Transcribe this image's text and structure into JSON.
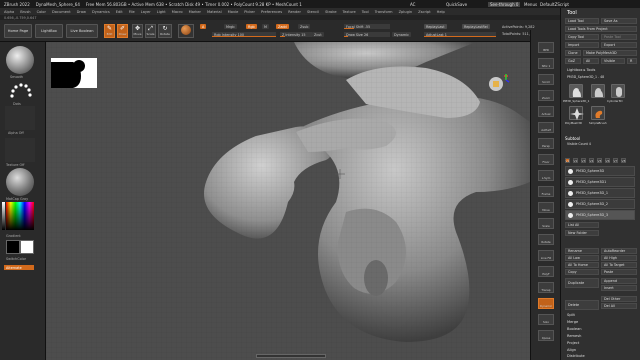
{
  "titlebar": {
    "app": "ZBrush 2022",
    "doc": "DynaMesh_Sphere_64",
    "stats": "Free Mem 56.803GB • Active Mem 638 • Scratch Disk 49 • Timer 0.002 • PolyCount 9.28 KP • MeshCount 1",
    "ac": "AC",
    "quicksave": "QuickSave",
    "seethrough": "See-through 0",
    "menus": "Menus",
    "script": "DefaultZScript"
  },
  "menubar": [
    "Alpha",
    "Brush",
    "Color",
    "Document",
    "Draw",
    "Dynamics",
    "Edit",
    "File",
    "Layer",
    "Light",
    "Macro",
    "Marker",
    "Material",
    "Movie",
    "Picker",
    "Preferences",
    "Render",
    "Stencil",
    "Stroke",
    "Texture",
    "Tool",
    "Transform",
    "Zplugin",
    "Zscript",
    "Help"
  ],
  "statusline": "0.656,-0.759,0.647",
  "toolbar": {
    "home": "Home Page",
    "lightbox": "LightBox",
    "live_boolean": "Live Boolean",
    "edit": "Edit",
    "draw": "Draw",
    "move": "Move",
    "scale": "Scale",
    "rotate": "Rotate",
    "a": "A",
    "mrgb": "Mrgb",
    "rgb": "Rgb",
    "m": "M",
    "zadd": "Zadd",
    "zsub": "Zsub",
    "zcut": "Zcut",
    "rgb_intensity": "Rgb Intensity 100",
    "z_intensity": "Z Intensity 15",
    "focal_shift": "Focal Shift -55",
    "draw_size": "Draw Size 26",
    "dynamic": "Dynamic",
    "replay_last": "ReplayLast",
    "replay_last_rel": "ReplayLastRel",
    "adjust_last": "AdjustLast 1",
    "active_points": "ActivePoints: 9,282",
    "total_points": "TotalPoints: 511,648"
  },
  "leftshelf": {
    "brush": "Smooth",
    "stroke": "Dots",
    "alpha": "Alpha Off",
    "texture": "Texture Off",
    "material": "MatCap Gray",
    "gradient": "Gradient",
    "switch_color": "SwitchColor",
    "alternate": "Alternate"
  },
  "rightshelf": [
    "BPR",
    "SPix 1",
    "Scroll",
    "Zoom",
    "Actual",
    "AAHalf",
    "Persp",
    "Floor",
    "L.Sym",
    "Frame",
    "Move",
    "Scale",
    "Rotate",
    "Line Fill",
    "PolyF",
    "Transp",
    "Dynamic",
    "Solo",
    "Xpose"
  ],
  "toolpanel": {
    "title": "Tool",
    "load_tool": "Load Tool",
    "save_as": "Save As",
    "load_from_project": "Load Tools From Project",
    "copy_tool": "Copy Tool",
    "paste_tool": "Paste Tool",
    "import": "Import",
    "export": "Export",
    "clone": "Clone",
    "make_polymesh": "Make PolyMesh3D",
    "goz": "GoZ",
    "all": "All",
    "visible": "Visible",
    "r": "R",
    "lightbox_tools": "Lightbox ▸ Tools",
    "current_tool": "PM3D_Sphere3D_1 . 48",
    "tool_thumbs": [
      "PM3D_Sphere3D_1",
      "PM3D_Sphere3D",
      "Cylinder3D",
      "PolyMesh3D",
      "SimpleBrush"
    ],
    "subtool_header": "Subtool",
    "visible_count": "Visible Count 4",
    "v_numbers": [
      "V1",
      "V2",
      "V3",
      "V4",
      "V5",
      "V6",
      "V7",
      "V8"
    ],
    "subtools": [
      "PM3D_Sphere3D",
      "PM3D_Sphere3D1",
      "PM3D_Sphere3D_1",
      "PM3D_Sphere3D_2",
      "PM3D_Sphere3D_3"
    ],
    "list_all": "List All",
    "auto_collapse": "Auto Collapse",
    "new_folder": "New Folder",
    "rename": "Rename",
    "auto_reorder": "AutoReorder",
    "all_low": "All Low",
    "all_high": "All High",
    "all_to_home": "All To Home",
    "all_to_target": "All To Target",
    "copy": "Copy",
    "paste": "Paste",
    "duplicate": "Duplicate",
    "append": "Append",
    "insert": "Insert",
    "delete": "Delete",
    "del_other": "Del Other",
    "del_all": "Del All",
    "split": "Split",
    "merge": "Merge",
    "boolean": "Boolean",
    "remesh": "Remesh",
    "project": "Project",
    "extract": "Extract",
    "align": "Align",
    "distribute": "Distribute"
  },
  "colors": {
    "accent": "#d36a1c",
    "bg": "#2a2a2a",
    "canvas": "#4d4d4d"
  }
}
